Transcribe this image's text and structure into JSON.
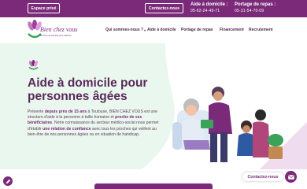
{
  "topbar": {
    "espace_label": "Espace privé",
    "contact_label": "Contactez-nous",
    "phones": [
      {
        "title": "Aide à domicile :",
        "number": "05-62-24-49-71"
      },
      {
        "title": "Portage de repas :",
        "number": "05-31-54-70-09"
      }
    ]
  },
  "header": {
    "logo_text": "Bien chez vous",
    "logo_sub": "services au domicile pour toulouse",
    "nav": [
      {
        "label": "Qui sommes-nous ?",
        "has_dropdown": true
      },
      {
        "label": "Aide à domicile"
      },
      {
        "label": "Portage de repas"
      },
      {
        "label": "Financement"
      },
      {
        "label": "Recrutement"
      }
    ]
  },
  "hero": {
    "title": "Aide à domicile pour personnes âgées",
    "text_parts": [
      "Présente ",
      "depuis près de 15 ans",
      " à Toulouse, BIEN CHEZ VOUS est une structure d'aide à la personne à taille humaine et ",
      "proche de ses bénéficiaires",
      ". Notre connaissance du secteur médico-social nous permet d'établir ",
      "une relation de confiance",
      " avec tous les proches qui veillent au bien-être de nos personnes âgées ou en situation de handicap."
    ]
  },
  "floating": {
    "contact_label": "Contactez-nous"
  },
  "colors": {
    "brand": "#7b2a7a",
    "hero_bg": "#eaf7ee",
    "accent_green": "#3aa35a"
  }
}
